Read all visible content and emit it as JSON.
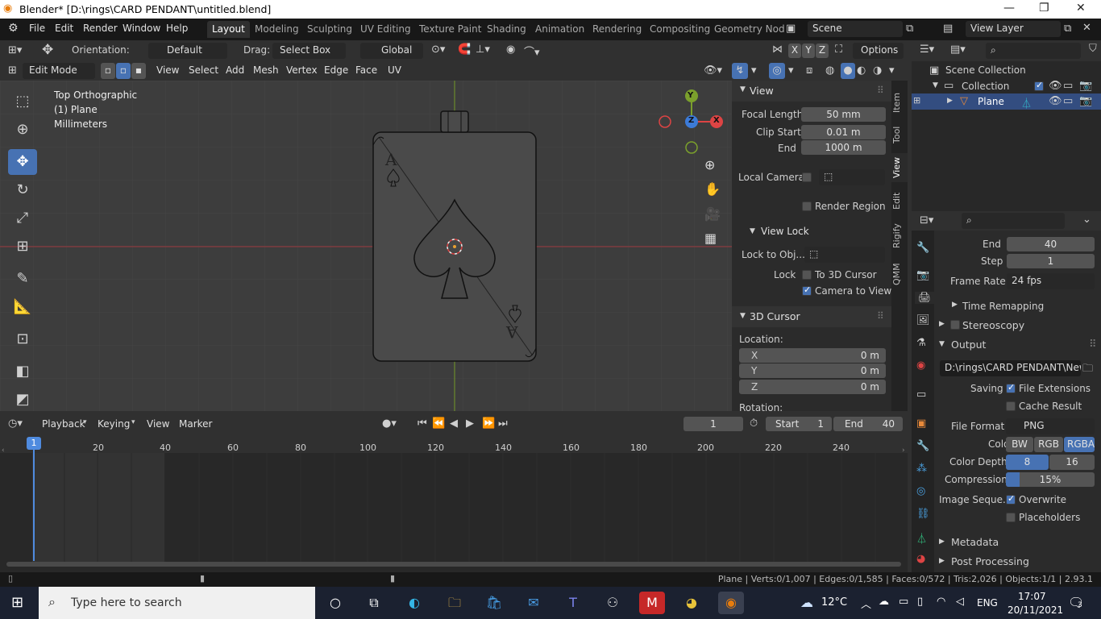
{
  "window": {
    "title": "Blender* [D:\\rings\\CARD PENDANT\\untitled.blend]",
    "min": "—",
    "max": "❐",
    "close": "✕"
  },
  "menubar": {
    "items": [
      "File",
      "Edit",
      "Render",
      "Window",
      "Help"
    ],
    "workspaces": [
      "Layout",
      "Modeling",
      "Sculpting",
      "UV Editing",
      "Texture Paint",
      "Shading",
      "Animation",
      "Rendering",
      "Compositing",
      "Geometry Nod"
    ],
    "scene": "Scene",
    "view_layer": "View Layer"
  },
  "toolheader": {
    "orientation_label": "Orientation:",
    "orientation_value": "Default",
    "drag_label": "Drag:",
    "drag_value": "Select Box",
    "transform_space": "Global",
    "axes": [
      "X",
      "Y",
      "Z"
    ],
    "options": "Options"
  },
  "viewport_header": {
    "mode": "Edit Mode",
    "menus": [
      "View",
      "Select",
      "Add",
      "Mesh",
      "Vertex",
      "Edge",
      "Face",
      "UV"
    ]
  },
  "viewport": {
    "overlay_lines": [
      "Top Orthographic",
      "(1) Plane",
      "Millimeters"
    ],
    "gizmo": {
      "x": "X",
      "y": "Y",
      "z": "Z"
    },
    "card_rank": "A"
  },
  "sidebar": {
    "tabs": [
      "Item",
      "Tool",
      "View",
      "Edit",
      "Rigify",
      "QMM"
    ],
    "view_panel": "View",
    "focal_length_label": "Focal Length",
    "focal_length": "50 mm",
    "clip_start_label": "Clip Start",
    "clip_start": "0.01 m",
    "end_label": "End",
    "end": "1000 m",
    "local_camera": "Local Camera",
    "render_region": "Render Region",
    "view_lock": "View Lock",
    "lock_to_obj": "Lock to Obj...",
    "lock": "Lock",
    "to_3d_cursor": "To 3D Cursor",
    "camera_to_view": "Camera to View",
    "cursor_panel": "3D Cursor",
    "location": "Location:",
    "x_label": "X",
    "x": "0 m",
    "y_label": "Y",
    "y": "0 m",
    "z_label": "Z",
    "z": "0 m",
    "rotation": "Rotation:"
  },
  "outliner": {
    "scene_collection": "Scene Collection",
    "collection": "Collection",
    "plane": "Plane"
  },
  "properties": {
    "frame_end_label": "End",
    "frame_end": "40",
    "step_label": "Step",
    "step": "1",
    "frame_rate_label": "Frame Rate",
    "frame_rate": "24 fps",
    "time_remapping": "Time Remapping",
    "stereoscopy": "Stereoscopy",
    "output": "Output",
    "output_path": "D:\\rings\\CARD PENDANT\\New ...",
    "saving": "Saving",
    "file_extensions": "File Extensions",
    "cache_result": "Cache Result",
    "file_format_label": "File Format",
    "file_format": "PNG",
    "color_label": "Color",
    "color_options": [
      "BW",
      "RGB",
      "RGBA"
    ],
    "color_depth_label": "Color Depth",
    "color_depth_options": [
      "8",
      "16"
    ],
    "compression_label": "Compression",
    "compression": "15%",
    "compression_fraction": 0.15,
    "image_seq_label": "Image Seque...",
    "overwrite": "Overwrite",
    "placeholders": "Placeholders",
    "metadata": "Metadata",
    "post_processing": "Post Processing"
  },
  "timeline": {
    "menus": [
      "Playback",
      "Keying",
      "View",
      "Marker"
    ],
    "current_frame": "1",
    "start_label": "Start",
    "start": "1",
    "end_label": "End",
    "end": "40",
    "ruler": [
      "1",
      "20",
      "40",
      "60",
      "80",
      "100",
      "120",
      "140",
      "160",
      "180",
      "200",
      "220",
      "240"
    ]
  },
  "statusbar": {
    "stats": "Plane | Verts:0/1,007 | Edges:0/1,585 | Faces:0/572 | Tris:2,026 | Objects:1/1 | 2.93.1"
  },
  "taskbar": {
    "search_placeholder": "Type here to search",
    "weather": "12°C",
    "lang": "ENG",
    "time": "17:07",
    "date": "20/11/2021",
    "notifications": "3"
  }
}
